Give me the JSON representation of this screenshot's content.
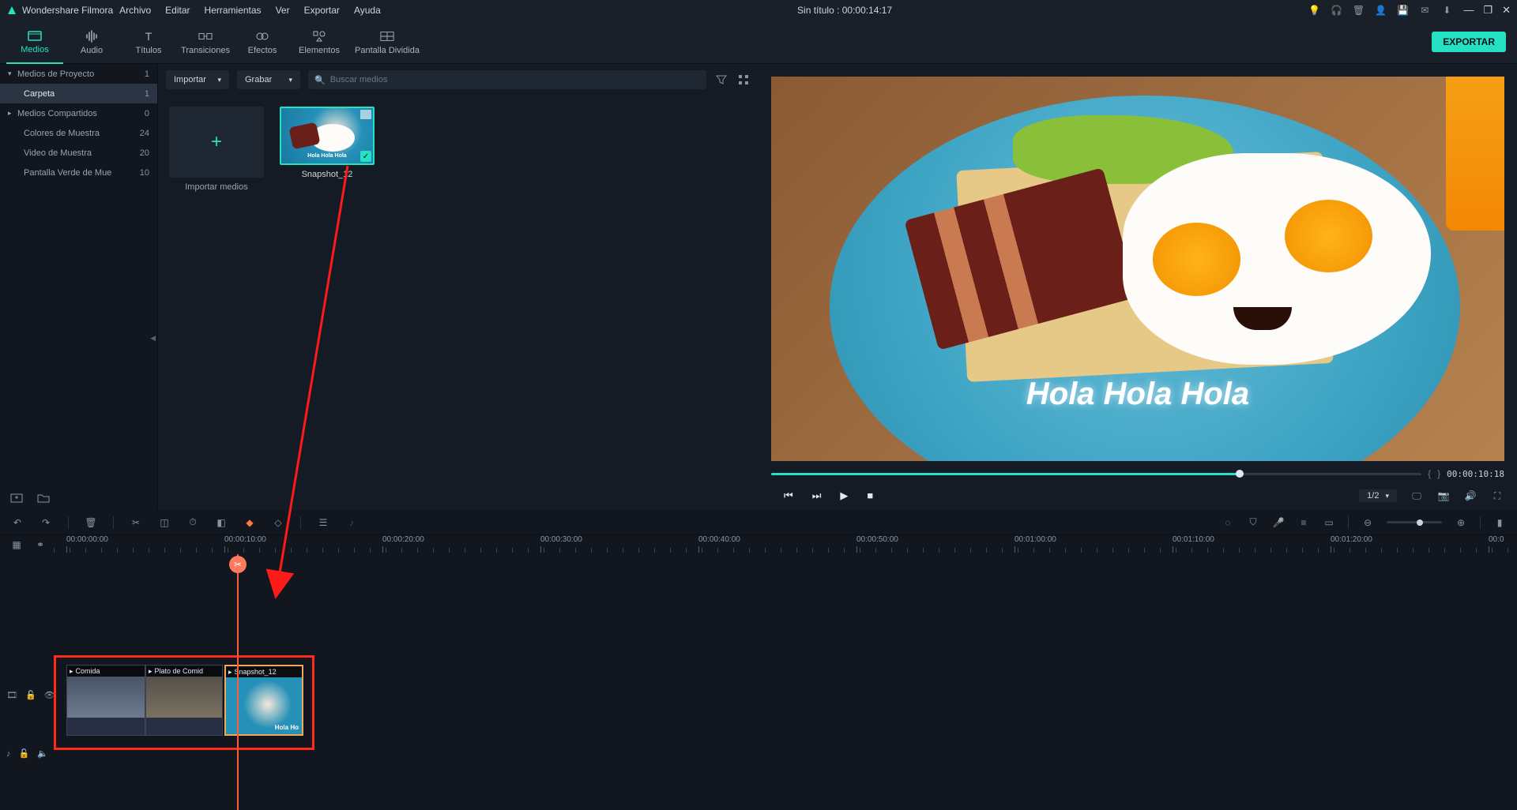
{
  "app": {
    "name": "Wondershare Filmora",
    "title_center": "Sin título : 00:00:14:17"
  },
  "menu": [
    "Archivo",
    "Editar",
    "Herramientas",
    "Ver",
    "Exportar",
    "Ayuda"
  ],
  "titlebar_icons": [
    "bulb-icon",
    "headphones-icon",
    "trash-icon",
    "user-icon",
    "save-icon",
    "mail-icon",
    "download-icon"
  ],
  "window_icons": {
    "min": "—",
    "restore": "❐",
    "close": "✕"
  },
  "tabs": [
    {
      "label": "Medios",
      "icon": "media-icon",
      "active": true
    },
    {
      "label": "Audio",
      "icon": "audio-icon"
    },
    {
      "label": "Títulos",
      "icon": "titles-icon"
    },
    {
      "label": "Transiciones",
      "icon": "transitions-icon"
    },
    {
      "label": "Efectos",
      "icon": "effects-icon"
    },
    {
      "label": "Elementos",
      "icon": "elements-icon"
    },
    {
      "label": "Pantalla Dividida",
      "icon": "splitscreen-icon"
    }
  ],
  "export_label": "EXPORTAR",
  "sidebar": [
    {
      "label": "Medios de Proyecto",
      "count": "1",
      "arrow": "▾"
    },
    {
      "label": "Carpeta",
      "count": "1",
      "indent": true,
      "selected": true
    },
    {
      "label": "Medios Compartidos",
      "count": "0",
      "arrow": "▸"
    },
    {
      "label": "Colores de Muestra",
      "count": "24",
      "indent": true
    },
    {
      "label": "Video de Muestra",
      "count": "20",
      "indent": true
    },
    {
      "label": "Pantalla Verde de Mue",
      "count": "10",
      "indent": true
    }
  ],
  "media_top": {
    "import": "Importar",
    "record": "Grabar",
    "search_placeholder": "Buscar medios",
    "filter_icon": "filter-icon",
    "grid_icon": "grid-icon"
  },
  "media": {
    "import_tile": "Importar medios",
    "clip": {
      "name": "Snapshot_12",
      "overlay_text": "Hola Hola Hola"
    }
  },
  "preview": {
    "overlay_text": "Hola Hola Hola",
    "timecode": "00:00:10:18",
    "brace_l": "{",
    "brace_r": "}",
    "ratio": "1/2",
    "icons": {
      "prev": "⏮",
      "next": "⏭",
      "play": "▶",
      "stop": "■",
      "display": "monitor-icon",
      "snapshot": "camera-icon",
      "volume": "volume-icon",
      "fullscreen": "fullscreen-icon"
    }
  },
  "tools": {
    "left": [
      "undo-icon",
      "redo-icon",
      "delete-icon",
      "cut-icon",
      "crop-icon",
      "speed-icon",
      "color-icon",
      "keyframe-icon",
      "marker-icon",
      "settings-icon",
      "mute-audio-icon"
    ],
    "right": [
      "render-icon",
      "shield-icon",
      "mic-icon",
      "mixer-icon",
      "frame-icon",
      "zoom-out-icon",
      "zoom-in-icon",
      "zoom-fit-icon"
    ]
  },
  "ruler": {
    "icons": [
      "thumbs-icon",
      "link-icon"
    ],
    "marks": [
      "00:00:00:00",
      "00:00:10:00",
      "00:00:20:00",
      "00:00:30:00",
      "00:00:40:00",
      "00:00:50:00",
      "00:01:00:00",
      "00:01:10:00",
      "00:01:20:00",
      "00:0"
    ]
  },
  "track_heads": {
    "video": {
      "icon": "video-track-icon",
      "lock": "lock-icon",
      "eye": "eye-icon"
    },
    "audio": {
      "icon": "audio-track-icon",
      "lock": "lock-icon",
      "mute": "mute-icon"
    }
  },
  "clips": [
    {
      "label": "Comida"
    },
    {
      "label": "Plato de Comid"
    },
    {
      "label": "Snapshot_12",
      "mini": "Hola Ho"
    }
  ],
  "left_bottom_icons": [
    "new-folder-icon",
    "folder-icon"
  ]
}
